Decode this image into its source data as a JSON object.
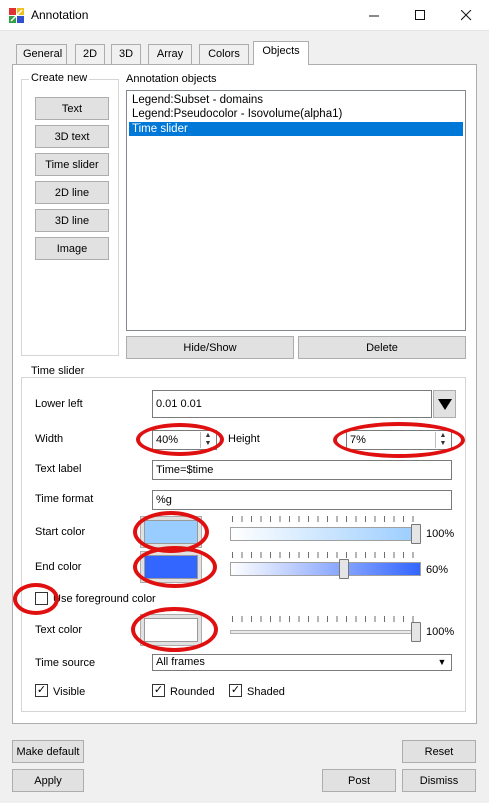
{
  "window": {
    "title": "Annotation",
    "minimize_icon": "minimize-icon",
    "maximize_icon": "maximize-icon",
    "close_icon": "close-icon"
  },
  "tabs": [
    {
      "label": "General"
    },
    {
      "label": "2D"
    },
    {
      "label": "3D"
    },
    {
      "label": "Array"
    },
    {
      "label": "Colors"
    },
    {
      "label": "Objects",
      "active": true
    }
  ],
  "create_new": {
    "title": "Create new",
    "buttons": [
      "Text",
      "3D text",
      "Time slider",
      "2D line",
      "3D line",
      "Image"
    ]
  },
  "annotation_objects": {
    "title": "Annotation objects",
    "items": [
      "Legend:Subset - domains",
      "Legend:Pseudocolor - Isovolume(alpha1)",
      "Time slider"
    ],
    "selected_index": 2,
    "hide_show_label": "Hide/Show",
    "delete_label": "Delete"
  },
  "time_slider": {
    "title": "Time slider",
    "lower_left_label": "Lower left",
    "lower_left_value": "0.01 0.01",
    "width_label": "Width",
    "width_value": "40%",
    "height_label": "Height",
    "height_value": "7%",
    "text_label_label": "Text label",
    "text_label_value": "Time=$time",
    "time_format_label": "Time format",
    "time_format_value": "%g",
    "start_color_label": "Start color",
    "start_color": "#99ccff",
    "start_opacity_text": "100%",
    "start_opacity": 1.0,
    "end_color_label": "End color",
    "end_color": "#3366ff",
    "end_opacity_text": "60%",
    "end_opacity": 0.6,
    "use_fg_label": "Use foreground color",
    "use_fg_checked": false,
    "text_color_label": "Text color",
    "text_color": "#ffffff",
    "text_opacity_text": "100%",
    "text_opacity": 1.0,
    "time_source_label": "Time source",
    "time_source_value": "All frames",
    "visible_label": "Visible",
    "visible_checked": true,
    "rounded_label": "Rounded",
    "rounded_checked": true,
    "shaded_label": "Shaded",
    "shaded_checked": true
  },
  "footer": {
    "make_default": "Make default",
    "reset": "Reset",
    "apply": "Apply",
    "post": "Post",
    "dismiss": "Dismiss"
  },
  "colors": {
    "selection": "#0078d7",
    "highlight_annotation": "#e01010"
  }
}
